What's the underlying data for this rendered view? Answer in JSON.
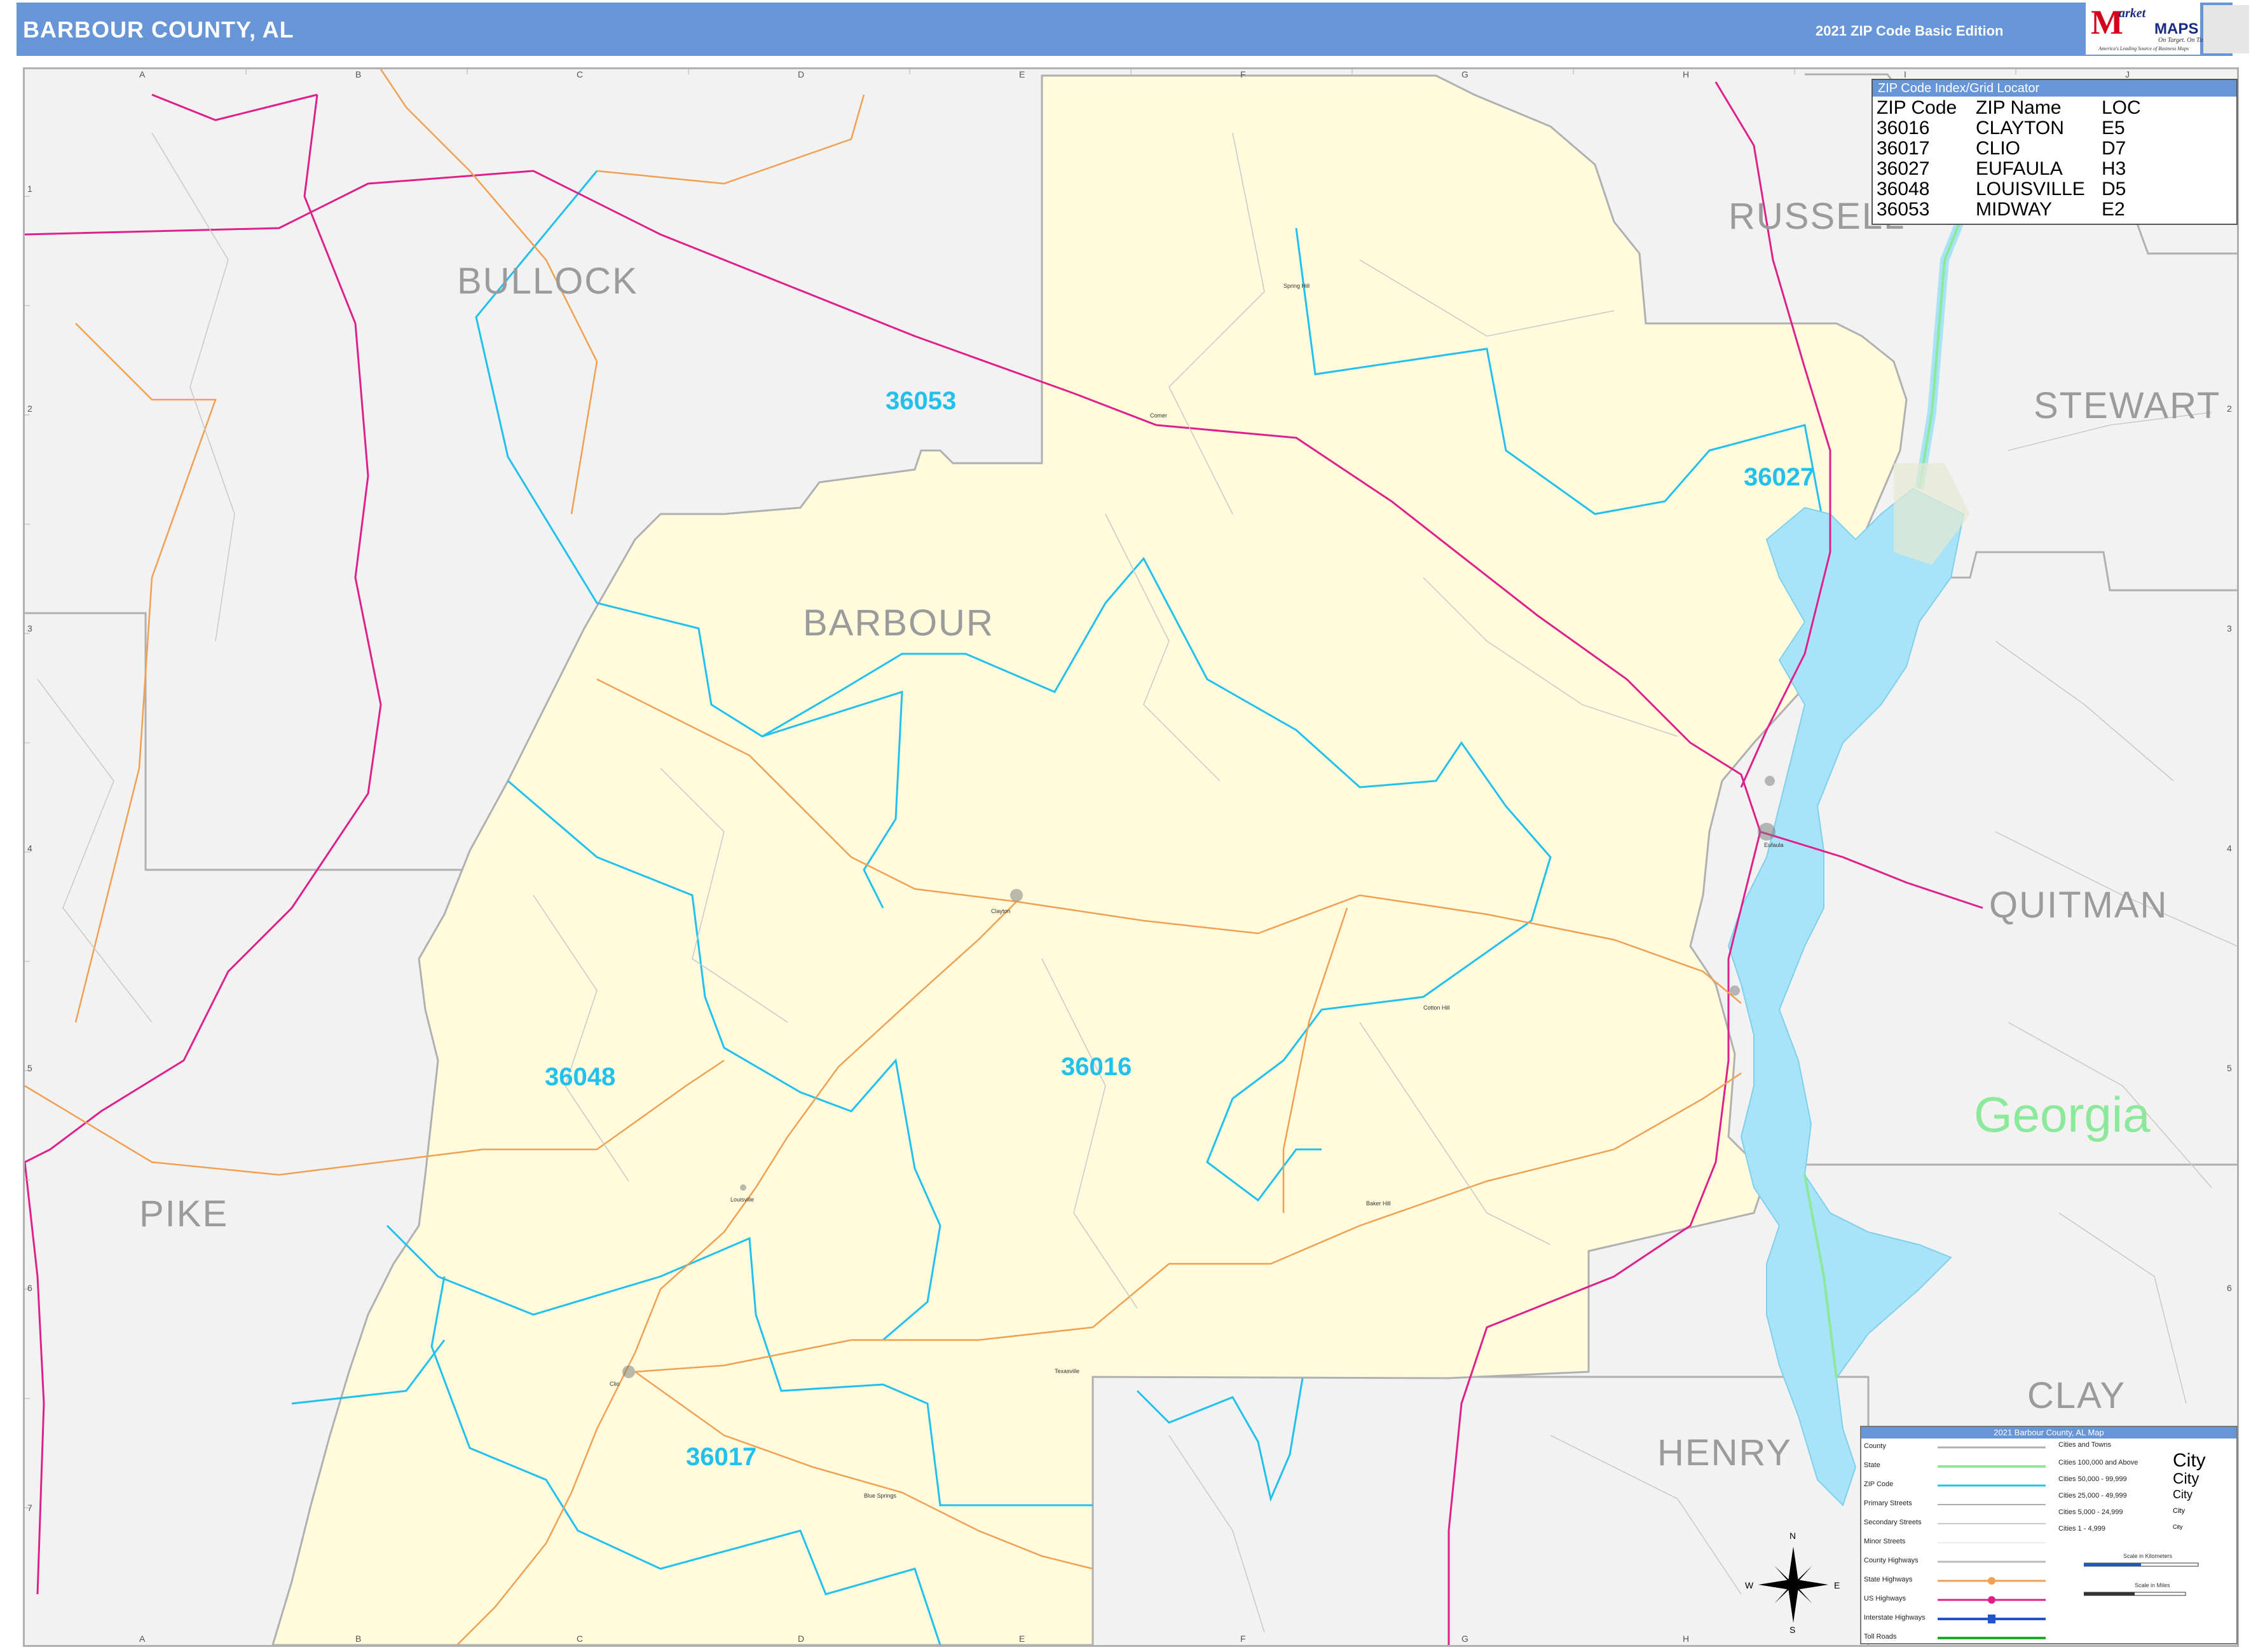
{
  "header": {
    "title": "BARBOUR COUNTY, AL",
    "edition": "2021 ZIP Code Basic Edition",
    "logo": {
      "m": "M",
      "arket": "arket",
      "maps": "MAPS",
      "tagline": "On Target. On Time.",
      "subtag": "America's Leading Source of Business Maps"
    }
  },
  "grid": {
    "columns": [
      "A",
      "B",
      "C",
      "D",
      "E",
      "F",
      "G",
      "H",
      "I",
      "J"
    ],
    "rows": [
      "1",
      "2",
      "3",
      "4",
      "5",
      "6",
      "7"
    ]
  },
  "counties": {
    "barbour": "BARBOUR",
    "bullock": "BULLOCK",
    "russell": "RUSSELL",
    "stewart": "STEWART",
    "quitman": "QUITMAN",
    "pike": "PIKE",
    "henry": "HENRY",
    "clay": "CLAY"
  },
  "state_label": "Georgia",
  "zip_labels": {
    "z36053": "36053",
    "z36027": "36027",
    "z36048": "36048",
    "z36016": "36016",
    "z36017": "36017"
  },
  "places": [
    "Clayton",
    "Louisville",
    "Clio",
    "Eufaula",
    "Cotton Hill",
    "Baker Hill",
    "Texasville",
    "Blue Springs",
    "Comer",
    "Spring Hill"
  ],
  "zip_index": {
    "title": "ZIP Code Index/Grid Locator",
    "headers": [
      "ZIP Code",
      "ZIP Name",
      "LOC"
    ],
    "rows": [
      [
        "36016",
        "CLAYTON",
        "E5"
      ],
      [
        "36017",
        "CLIO",
        "D7"
      ],
      [
        "36027",
        "EUFAULA",
        "H3"
      ],
      [
        "36048",
        "LOUISVILLE",
        "D5"
      ],
      [
        "36053",
        "MIDWAY",
        "E2"
      ]
    ]
  },
  "legend": {
    "title": "2021 Barbour County, AL Map",
    "left_items": [
      "County",
      "State",
      "ZIP Code",
      "Primary Streets",
      "Secondary Streets",
      "Minor Streets",
      "County Highways",
      "State Highways",
      "US Highways",
      "Interstate Highways",
      "Toll Roads"
    ],
    "cities_header": "Cities and Towns",
    "city_items": [
      "Cities 100,000 and Above",
      "Cities 50,000 - 99,999",
      "Cities 25,000 - 49,999",
      "Cities 5,000 - 24,999",
      "Cities 1 - 4,999"
    ],
    "city_samples": [
      "City",
      "City",
      "City",
      "City",
      "City"
    ],
    "scale_km": "Scale in Kilometers",
    "scale_mi": "Scale in Miles",
    "colors": {
      "county": "#b0b0b0",
      "state": "#8ce89a",
      "zip": "#22c0ec",
      "us_highway": "#e0208a",
      "state_highway": "#f0a050",
      "water": "#a9e3f7",
      "barbour_fill": "#fffbdc"
    }
  },
  "compass": {
    "n": "N",
    "s": "S",
    "e": "E",
    "w": "W"
  }
}
